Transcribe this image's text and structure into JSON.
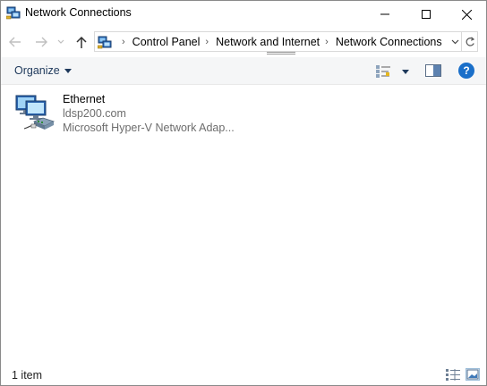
{
  "window": {
    "title": "Network Connections",
    "controls": {
      "minimize": "minimize",
      "maximize": "maximize",
      "close": "close"
    }
  },
  "address_bar": {
    "crumbs": [
      "Control Panel",
      "Network and Internet",
      "Network Connections"
    ],
    "icons": [
      "back-arrow-icon",
      "forward-arrow-icon",
      "chevron-down-icon",
      "up-arrow-icon",
      "network-folder-icon",
      "refresh-icon"
    ]
  },
  "toolbar": {
    "organize_label": "Organize",
    "help_label": "?"
  },
  "items": [
    {
      "name": "Ethernet",
      "network": "ldsp200.com",
      "device": "Microsoft Hyper-V Network Adap..."
    }
  ],
  "status": {
    "count": "1 item"
  },
  "colors": {
    "accent": "#1a6fc9",
    "command_bar_bg": "#f5f6f7",
    "secondary_text": "#6d6d6d"
  }
}
